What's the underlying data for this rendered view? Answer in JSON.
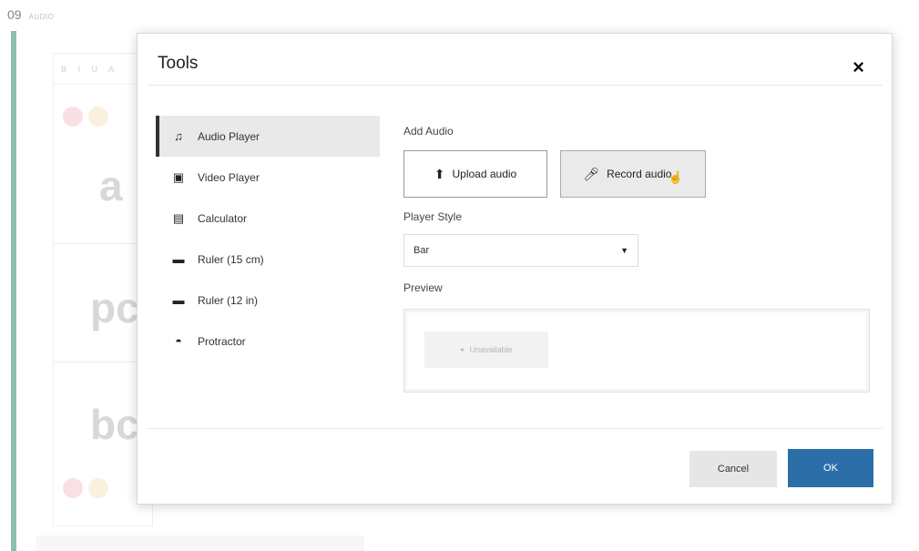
{
  "background": {
    "section_number": "09",
    "section_label": "AUDIO",
    "toolbar_text": "B I U A",
    "words": [
      "a",
      "pc",
      "bc"
    ],
    "accent_color": "#2e8b6f"
  },
  "dialog": {
    "title": "Tools",
    "close_icon": "×",
    "sidebar": {
      "items": [
        {
          "label": "Audio Player",
          "icon": "music-note-icon",
          "glyph": "♫",
          "active": true
        },
        {
          "label": "Video Player",
          "icon": "video-icon",
          "glyph": "▣",
          "active": false
        },
        {
          "label": "Calculator",
          "icon": "calculator-icon",
          "glyph": "▤",
          "active": false
        },
        {
          "label": "Ruler (15 cm)",
          "icon": "ruler-icon",
          "glyph": "▬",
          "active": false
        },
        {
          "label": "Ruler (12 in)",
          "icon": "ruler-icon",
          "glyph": "▬",
          "active": false
        },
        {
          "label": "Protractor",
          "icon": "protractor-icon",
          "glyph": "◓",
          "active": false
        }
      ]
    },
    "content": {
      "add_audio_label": "Add Audio",
      "upload_button": "Upload audio",
      "record_button": "Record audio",
      "player_style_label": "Player Style",
      "player_style_value": "Bar",
      "preview_label": "Preview",
      "preview_unavailable": "Unavailable"
    },
    "footer": {
      "cancel": "Cancel",
      "ok": "OK"
    },
    "colors": {
      "primary": "#2c6fa8",
      "active_item_bg": "#e9e9e9"
    }
  }
}
